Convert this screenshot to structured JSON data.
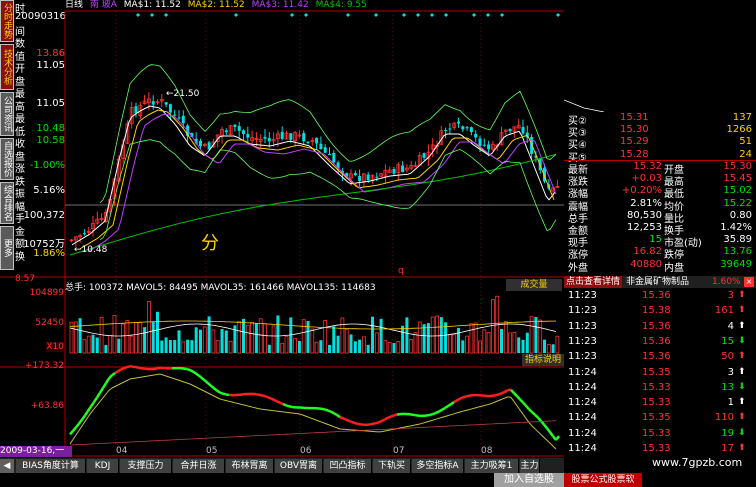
{
  "left_tabs": [
    "分时走势",
    "技术分析",
    "公司资讯",
    "自选报价",
    "综合排名",
    "更多"
  ],
  "info": {
    "date": "20090316",
    "rows": [
      {
        "label": "时",
        "value": "",
        "color": "#ffffff"
      },
      {
        "label": "间",
        "value": "",
        "color": "#ffffff"
      },
      {
        "label": "数",
        "value": "",
        "color": "#ffffff"
      },
      {
        "label": "值",
        "value": "13.86",
        "color": "#ff3232"
      },
      {
        "label": "开",
        "value": "11.05",
        "color": "#ffffff"
      },
      {
        "label": "盘",
        "value": "",
        "color": "#ffffff"
      },
      {
        "label": "最",
        "value": "",
        "color": "#ffffff"
      },
      {
        "label": "高",
        "value": "11.05",
        "color": "#ffffff"
      },
      {
        "label": "最",
        "value": "",
        "color": "#ffffff"
      },
      {
        "label": "低",
        "value": "10.48",
        "color": "#00e000"
      },
      {
        "label": "收",
        "value": "10.58",
        "color": "#00e000"
      },
      {
        "label": "盘",
        "value": "",
        "color": "#ffffff"
      },
      {
        "label": "涨",
        "value": "-1.00%",
        "color": "#00e000"
      },
      {
        "label": "跌",
        "value": "",
        "color": "#ffffff"
      },
      {
        "label": "振",
        "value": "5.16%",
        "color": "#ffffff"
      },
      {
        "label": "幅",
        "value": "",
        "color": "#ffffff"
      },
      {
        "label": "手",
        "value": "100,372",
        "color": "#ffffff"
      },
      {
        "label": "金",
        "value": "",
        "color": "#ffffff"
      },
      {
        "label": "额",
        "value": "10752万",
        "color": "#ffffff"
      },
      {
        "label": "换",
        "value": "1.86%",
        "color": "#ffd200"
      }
    ],
    "bottom_value": "8.57"
  },
  "header": {
    "stock_name": "南 玻A",
    "period": "日线",
    "ma1": "MA$1: 11.52",
    "ma2": "MA$2: 11.52",
    "ma3": "MA$3: 11.42",
    "ma4": "MA$4: 9.55"
  },
  "chart": {
    "annotation_high": "←21.50",
    "annotation_low": "←10.48",
    "watermark_char": "分",
    "vol_header": "总手: 100372 MAVOL5: 84495 MAVOL35: 161466 MAVOL135: 114683",
    "vol_title": "成交量",
    "vol_axis": [
      "104899",
      "52450",
      "X10"
    ],
    "indicator_btn": "指标说明",
    "ind_axis": [
      "+173.32",
      "+63.86"
    ],
    "date_axis": [
      "2009-03-16,一",
      "04",
      "05",
      "06",
      "07",
      "08"
    ]
  },
  "quote": {
    "asks": [
      {
        "label": "买②",
        "price": "15.31",
        "vol": "137"
      },
      {
        "label": "买③",
        "price": "15.30",
        "vol": "1266"
      },
      {
        "label": "买④",
        "price": "15.29",
        "vol": "51"
      },
      {
        "label": "买⑤",
        "price": "15.28",
        "vol": "24"
      }
    ],
    "stats": [
      {
        "l1": "最新",
        "v1": "15.32",
        "l2": "开盘",
        "v2": "15.30",
        "c1": "#ff3232",
        "c2": "#ff3232"
      },
      {
        "l1": "涨跌",
        "v1": "+0.03",
        "l2": "最高",
        "v2": "15.45",
        "c1": "#ff3232",
        "c2": "#ff3232"
      },
      {
        "l1": "涨幅",
        "v1": "+0.20%",
        "l2": "最低",
        "v2": "15.02",
        "c1": "#ff3232",
        "c2": "#00e000"
      },
      {
        "l1": "震幅",
        "v1": "2.81%",
        "l2": "均价",
        "v2": "15.22",
        "c1": "#ffffff",
        "c2": "#00e000"
      },
      {
        "l1": "总手",
        "v1": "80,530",
        "l2": "量比",
        "v2": "0.80",
        "c1": "#ffffff",
        "c2": "#ffffff"
      },
      {
        "l1": "金额",
        "v1": "12,253",
        "l2": "换手",
        "v2": "1.42%",
        "c1": "#ffffff",
        "c2": "#ffffff"
      },
      {
        "l1": "现手",
        "v1": "15",
        "l2": "市盈(动)",
        "v2": "35.89",
        "c1": "#00e000",
        "c2": "#ffffff"
      },
      {
        "l1": "涨停",
        "v1": "16.82",
        "l2": "跌停",
        "v2": "13.76",
        "c1": "#ff3232",
        "c2": "#00e000"
      },
      {
        "l1": "外盘",
        "v1": "40880",
        "l2": "内盘",
        "v2": "39649",
        "c1": "#ff3232",
        "c2": "#00e000"
      }
    ],
    "detail_btn": "点击查看详情",
    "sector_name": "非金属矿物制品",
    "sector_pct": "1.60%",
    "ticks": [
      {
        "time": "11:23",
        "price": "15.36",
        "vol": "3",
        "dir": "up"
      },
      {
        "time": "11:23",
        "price": "15.38",
        "vol": "161",
        "dir": "up"
      },
      {
        "time": "11:23",
        "price": "15.36",
        "vol": "4",
        "dir": "up-w"
      },
      {
        "time": "11:23",
        "price": "15.36",
        "vol": "15",
        "dir": "down"
      },
      {
        "time": "11:23",
        "price": "15.36",
        "vol": "50",
        "dir": "up"
      },
      {
        "time": "11:24",
        "price": "15.35",
        "vol": "3",
        "dir": "up-w"
      },
      {
        "time": "11:24",
        "price": "15.33",
        "vol": "13",
        "dir": "down"
      },
      {
        "time": "11:24",
        "price": "15.33",
        "vol": "1",
        "dir": "up-w"
      },
      {
        "time": "11:24",
        "price": "15.35",
        "vol": "110",
        "dir": "up"
      },
      {
        "time": "11:24",
        "price": "15.33",
        "vol": "19",
        "dir": "down"
      },
      {
        "time": "11:24",
        "price": "15.33",
        "vol": "17",
        "dir": "up"
      }
    ],
    "watermark": "www.7gpzb.com",
    "bottom_banner": "股票公式股票软"
  },
  "bottom_tabs": [
    "BIAS角度计算",
    "KDJ",
    "支撑压力",
    "合并日涨",
    "布林胃离",
    "OBV胃离",
    "凹凸指标",
    "下轨买",
    "多空指标A",
    "主力吸筹1",
    "主力"
  ],
  "join_button": "加入自选股",
  "colors": {
    "up": "#ff3232",
    "down": "#00e0e0",
    "ma_white": "#ffffff",
    "ma_yellow": "#ffd200",
    "ma_green": "#00c000",
    "ma_purple": "#c040ff",
    "axis": "#b00000"
  }
}
